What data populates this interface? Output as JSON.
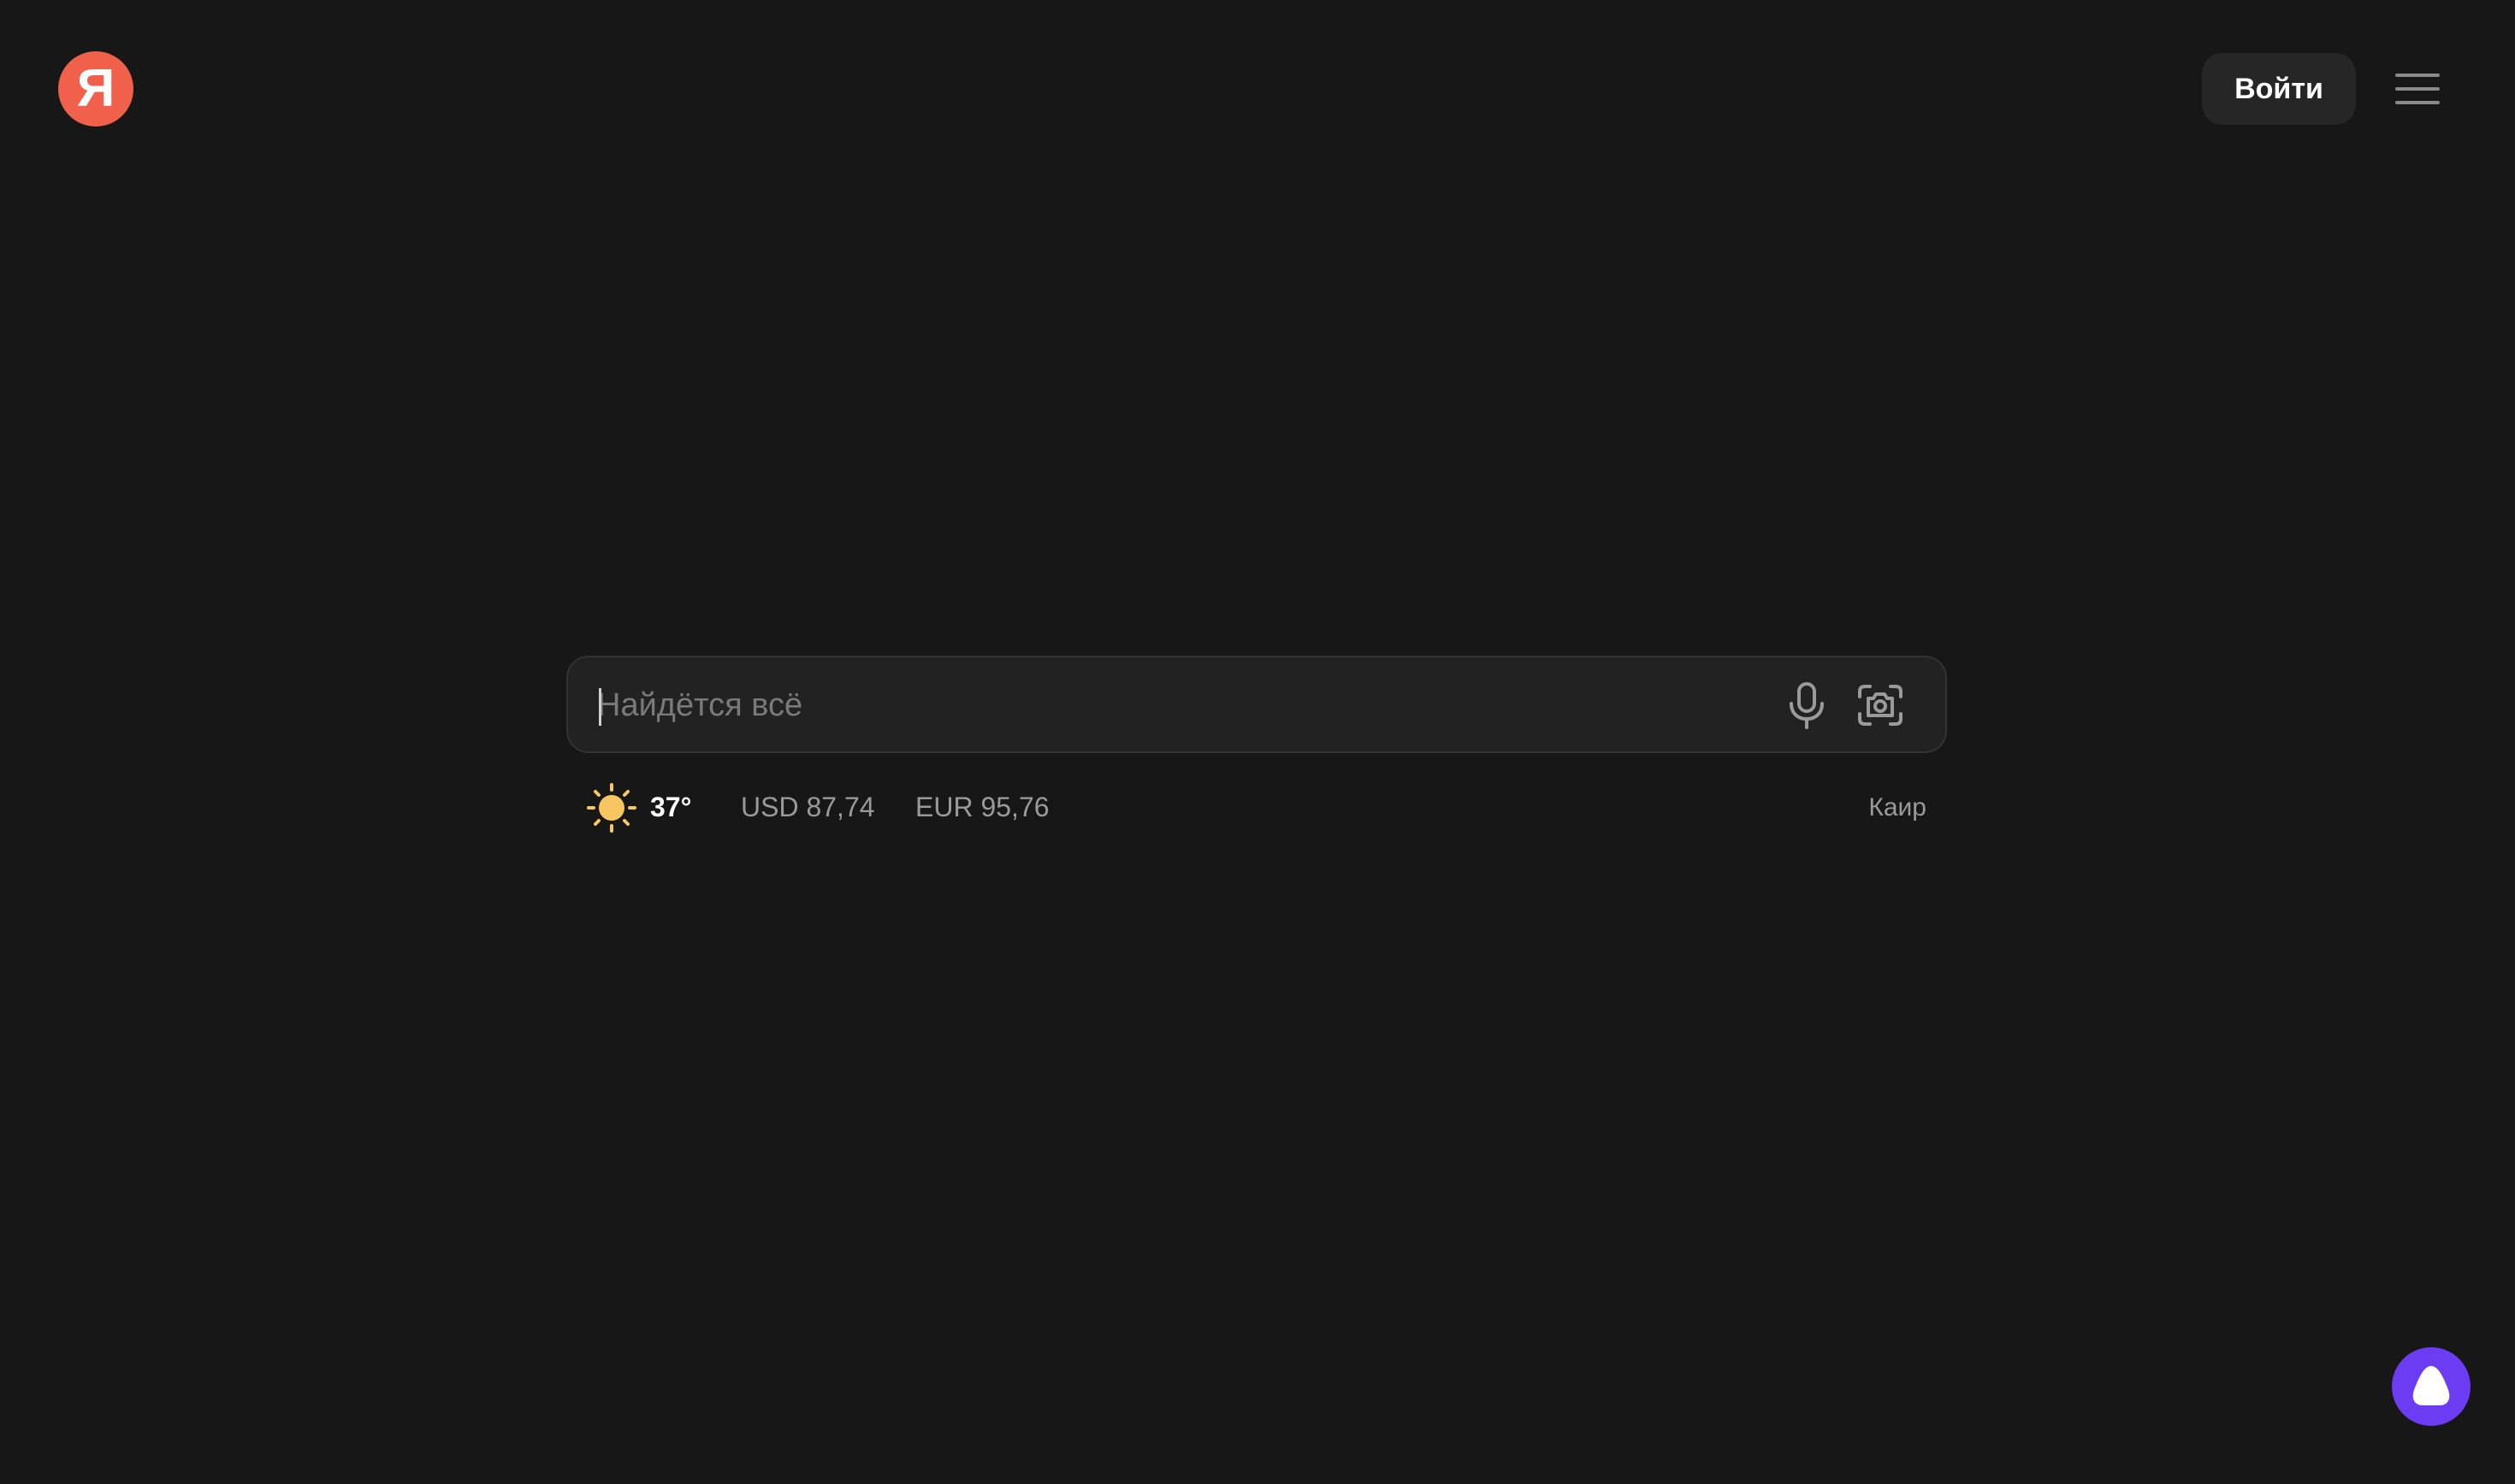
{
  "header": {
    "logo_letter": "Я",
    "logo_color": "#f0604a",
    "login_label": "Войти",
    "menu_icon": "hamburger-icon"
  },
  "search": {
    "placeholder": "Найдётся всё",
    "value": "",
    "mic_icon": "microphone-icon",
    "camera_icon": "camera-search-icon"
  },
  "info": {
    "weather_icon": "sun-icon",
    "temperature": "37°",
    "usd": "USD 87,74",
    "eur": "EUR 95,76",
    "city": "Каир"
  },
  "assistant": {
    "icon": "alice-icon",
    "color": "#6b3cf2"
  }
}
